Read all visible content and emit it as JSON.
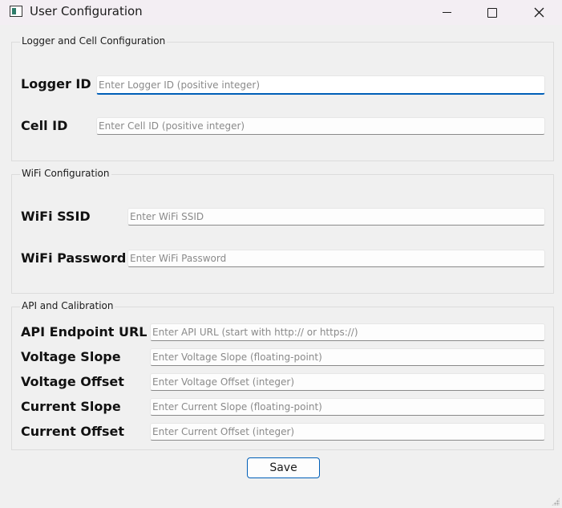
{
  "window": {
    "title": "User Configuration",
    "icons": {
      "app": "app-window-icon",
      "minimize": "minimize-icon",
      "maximize": "maximize-icon",
      "close": "close-icon"
    }
  },
  "groups": {
    "logger": {
      "title": "Logger and Cell Configuration",
      "logger_id_label": "Logger ID",
      "logger_id_placeholder": "Enter Logger ID (positive integer)",
      "cell_id_label": "Cell ID",
      "cell_id_placeholder": "Enter Cell ID (positive integer)"
    },
    "wifi": {
      "title": "WiFi Configuration",
      "ssid_label": "WiFi SSID",
      "ssid_placeholder": "Enter WiFi SSID",
      "password_label": "WiFi Password",
      "password_placeholder": "Enter WiFi Password"
    },
    "api": {
      "title": "API and Calibration",
      "url_label": "API Endpoint URL",
      "url_placeholder": "Enter API URL (start with http:// or https://)",
      "voltage_slope_label": "Voltage Slope",
      "voltage_slope_placeholder": "Enter Voltage Slope (floating-point)",
      "voltage_offset_label": "Voltage Offset",
      "voltage_offset_placeholder": "Enter Voltage Offset (integer)",
      "current_slope_label": "Current Slope",
      "current_slope_placeholder": "Enter Current Slope (floating-point)",
      "current_offset_label": "Current Offset",
      "current_offset_placeholder": "Enter Current Offset (integer)"
    }
  },
  "actions": {
    "save_label": "Save"
  },
  "colors": {
    "accent": "#005fb8",
    "background": "#f0f0f0",
    "titlebar": "#f3eef3"
  }
}
